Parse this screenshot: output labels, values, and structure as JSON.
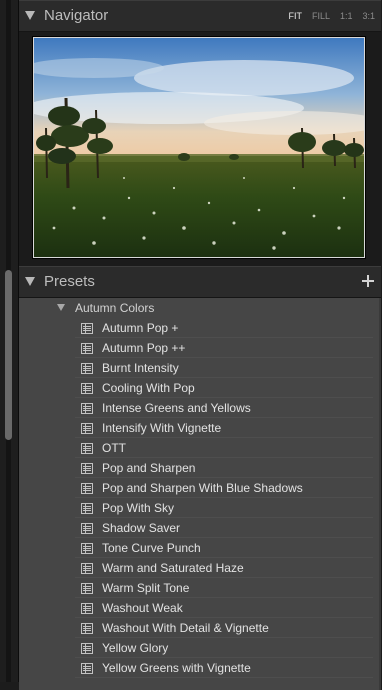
{
  "navigator": {
    "title": "Navigator",
    "zoom_options": [
      "FIT",
      "FILL",
      "1:1",
      "3:1"
    ],
    "active_zoom": "FIT"
  },
  "presets": {
    "title": "Presets",
    "folder": "Autumn Colors",
    "items": [
      "Autumn Pop +",
      "Autumn Pop ++",
      "Burnt Intensity",
      "Cooling With Pop",
      "Intense Greens and Yellows",
      "Intensify With Vignette",
      "OTT",
      "Pop and Sharpen",
      "Pop and Sharpen With Blue Shadows",
      "Pop With Sky",
      "Shadow Saver",
      "Tone Curve Punch",
      "Warm and Saturated Haze",
      "Warm Split Tone",
      "Washout Weak",
      "Washout With Detail & Vignette",
      "Yellow Glory",
      "Yellow Greens with Vignette"
    ]
  },
  "icons": {
    "collapse": "triangle-down-icon",
    "add": "plus-icon",
    "preset": "preset-grid-icon"
  }
}
